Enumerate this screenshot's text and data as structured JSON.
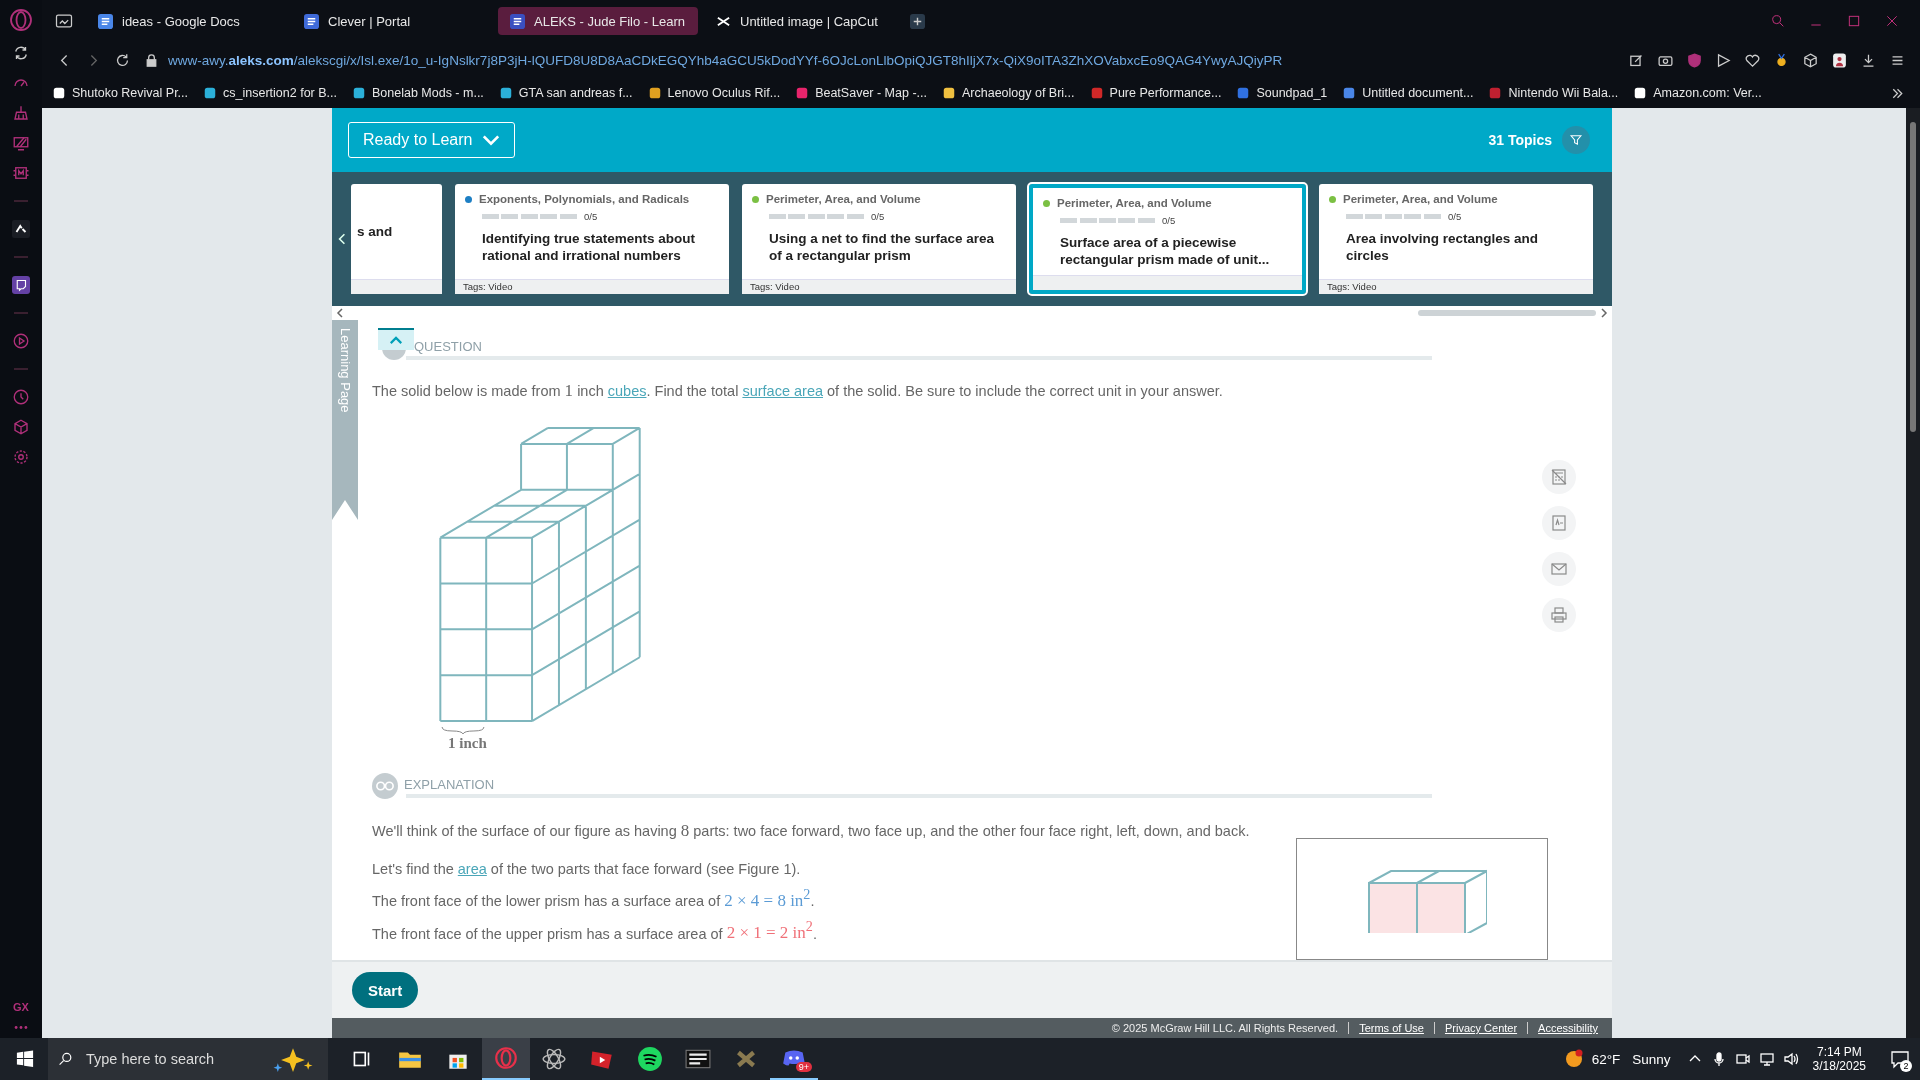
{
  "browser": {
    "tabs": [
      {
        "title": "ideas - Google Docs",
        "selected": false
      },
      {
        "title": "Clever | Portal",
        "selected": false
      },
      {
        "title": "ALEKS - Jude Filo - Learn",
        "selected": true
      },
      {
        "title": "Untitled image | CapCut",
        "selected": false
      }
    ],
    "url": "www-awy.**aleks.com**/alekscgi/x/Isl.exe/1o_u-IgNslkr7j8P3jH-lQUFD8U8D8AaCDkEGQYhb4aGCU5kDodYYf-6OJcLonLlbOpiQJGT8hIljX7x-QiX9oITA3ZhXOVabxcEo9QAG4YwyAJQiyPR",
    "bookmarks": [
      "Shutoko Revival Pr...",
      "cs_insertion2 for B...",
      "Bonelab Mods - m...",
      "GTA san andreas f...",
      "Lenovo Oculus Rif...",
      "BeatSaver - Map -...",
      "Archaeology of Bri...",
      "Pure Performance...",
      "Soundpad_1",
      "Untitled document...",
      "Nintendo Wii Bala...",
      "Amazon.com: Ver..."
    ],
    "sidebar_label": "GX"
  },
  "aleks": {
    "dropdown": "Ready to Learn",
    "topics_count": "31 Topics",
    "partial_card_title": "s and",
    "cards": [
      {
        "category": "Exponents, Polynomials, and Radicals",
        "color": "#1d7fc4",
        "level": 0,
        "progress": "0/5",
        "title": "Identifying true statements about rational and irrational numbers",
        "tags": "Tags: Video",
        "selected": false
      },
      {
        "category": "Perimeter, Area, and Volume",
        "color": "#7bc043",
        "level": 0,
        "progress": "0/5",
        "title": "Using a net to find the surface area of a rectangular prism",
        "tags": "Tags: Video",
        "selected": false
      },
      {
        "category": "Perimeter, Area, and Volume",
        "color": "#7bc043",
        "level": 0,
        "progress": "0/5",
        "title": "Surface area of a piecewise rectangular prism made of unit...",
        "selected": true
      },
      {
        "category": "Perimeter, Area, and Volume",
        "color": "#7bc043",
        "level": 0,
        "progress": "0/5",
        "title": "Area involving rectangles and circles",
        "tags": "Tags: Video",
        "selected": false
      }
    ],
    "side_tab": "Learning Page",
    "question": {
      "heading": "QUESTION",
      "segments": [
        {
          "kind": "text",
          "text": "The solid below is made from "
        },
        {
          "kind": "math",
          "text": "1"
        },
        {
          "kind": "text",
          "text": " inch "
        },
        {
          "kind": "link",
          "text": "cubes"
        },
        {
          "kind": "text",
          "text": ". Find the total "
        },
        {
          "kind": "link",
          "text": "surface area"
        },
        {
          "kind": "text",
          "text": " of the solid. Be sure to include the correct unit in your answer."
        }
      ],
      "figure_label": "1 inch"
    },
    "explanation": {
      "heading": "EXPLANATION",
      "paragraphs": [
        [
          {
            "kind": "text",
            "text": "We'll think of the surface of our figure as having "
          },
          {
            "kind": "math",
            "text": "8"
          },
          {
            "kind": "text",
            "text": " parts: two face forward, two face up, and the other four face right, left, down, and back."
          }
        ],
        [
          {
            "kind": "text",
            "text": "Let's find the "
          },
          {
            "kind": "link",
            "text": "area"
          },
          {
            "kind": "text",
            "text": " of the two parts that face forward (see Figure 1)."
          }
        ],
        [
          {
            "kind": "text",
            "text": "The front face of the lower prism has a surface area of "
          },
          {
            "kind": "math",
            "text": "2 × 4 = 8 in$^{2}$",
            "color": "#5b9bd5"
          },
          {
            "kind": "text",
            "text": "."
          }
        ],
        [
          {
            "kind": "text",
            "text": "The front face of the upper prism has a surface area of "
          },
          {
            "kind": "math",
            "text": "2 × 1 = 2 in$^{2}$",
            "color": "#f07078"
          },
          {
            "kind": "text",
            "text": "."
          }
        ]
      ]
    },
    "start_button": "Start",
    "footer": {
      "copyright": "© 2025 McGraw Hill LLC. All Rights Reserved.",
      "links": [
        "Terms of Use",
        "Privacy Center",
        "Accessibility"
      ]
    }
  },
  "taskbar": {
    "search_placeholder": "Type here to search",
    "chat_badge": "9+",
    "temperature": "62°F",
    "weather": "Sunny",
    "time": "7:14 PM",
    "date": "3/18/2025",
    "notifications": "2"
  }
}
